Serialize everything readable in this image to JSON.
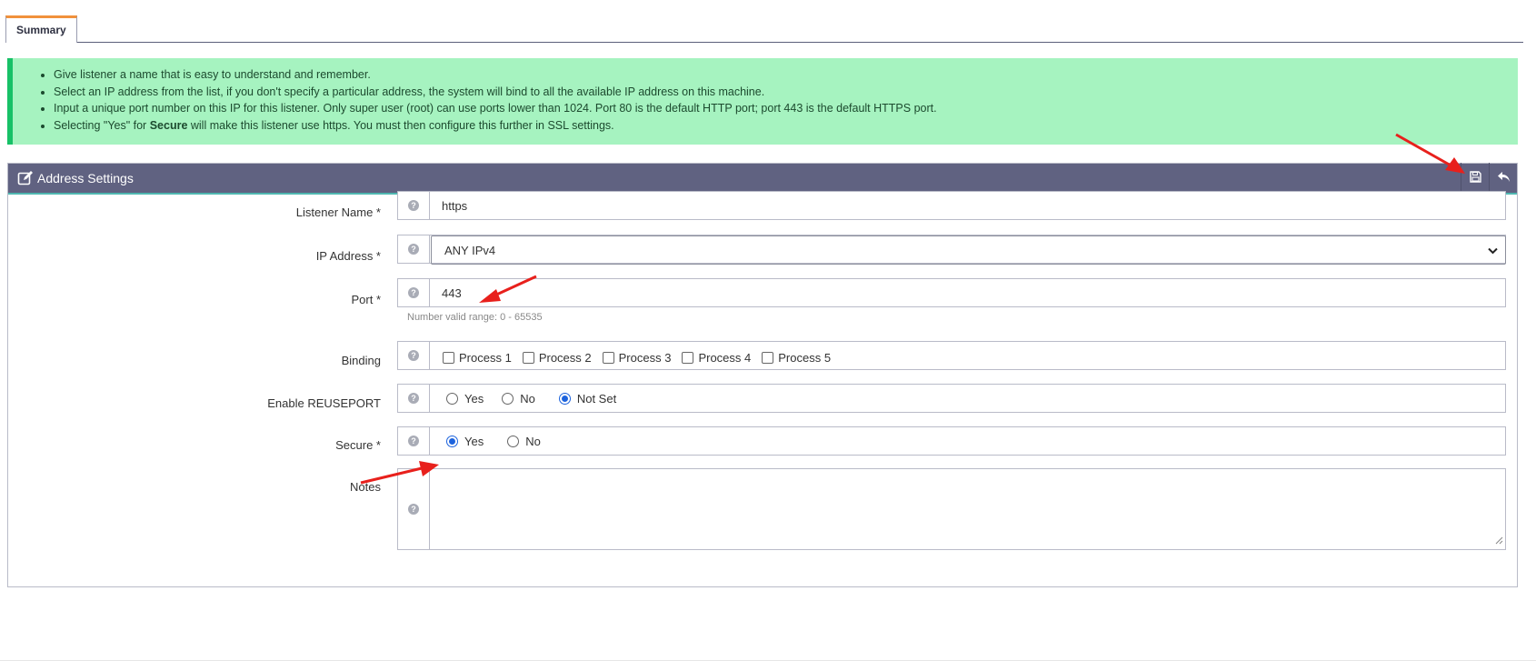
{
  "tabs": [
    {
      "label": "Summary",
      "active": true
    }
  ],
  "info": {
    "items": [
      "Give listener a name that is easy to understand and remember.",
      "Select an IP address from the list, if you don't specify a particular address, the system will bind to all the available IP address on this machine.",
      "Input a unique port number on this IP for this listener. Only super user (root) can use ports lower than 1024. Port 80 is the default HTTP port; port 443 is the default HTTPS port."
    ],
    "secure_prefix": "Selecting \"Yes\" for ",
    "secure_bold": "Secure",
    "secure_suffix": " will make this listener use https. You must then configure this further in SSL settings."
  },
  "panel": {
    "title": "Address Settings",
    "icons": {
      "title": "edit-icon",
      "save": "save-icon",
      "back": "undo-icon"
    }
  },
  "form": {
    "listener_name": {
      "label": "Listener Name *",
      "value": "https"
    },
    "ip_address": {
      "label": "IP Address *",
      "value": "ANY IPv4"
    },
    "port": {
      "label": "Port *",
      "value": "443",
      "hint": "Number valid range: 0 - 65535"
    },
    "binding": {
      "label": "Binding",
      "options": [
        "Process 1",
        "Process 2",
        "Process 3",
        "Process 4",
        "Process 5"
      ]
    },
    "reuseport": {
      "label": "Enable REUSEPORT",
      "options": [
        "Yes",
        "No",
        "Not Set"
      ],
      "selected": "Not Set"
    },
    "secure": {
      "label": "Secure *",
      "options": [
        "Yes",
        "No"
      ],
      "selected": "Yes"
    },
    "notes": {
      "label": "Notes",
      "value": ""
    },
    "help_glyph": "?"
  },
  "colors": {
    "panel_header": "#606281",
    "info_bg": "#a6f3c0",
    "info_border": "#17c167",
    "tab_accent": "#f1913b",
    "radio_selected": "#1d63dd",
    "annotation_arrow": "#e8201c"
  }
}
